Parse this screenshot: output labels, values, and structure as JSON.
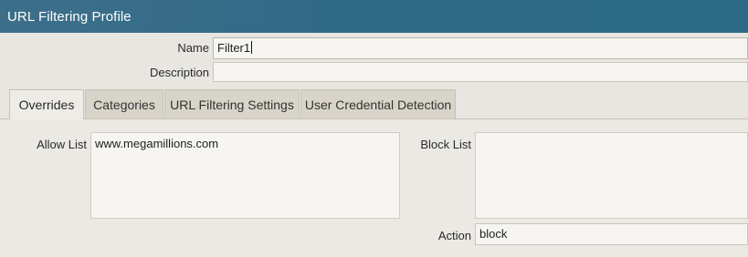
{
  "window": {
    "title": "URL Filtering Profile"
  },
  "form": {
    "name_label": "Name",
    "name_value": "Filter1",
    "description_label": "Description",
    "description_value": ""
  },
  "tabs": [
    {
      "label": "Overrides",
      "active": true
    },
    {
      "label": "Categories",
      "active": false
    },
    {
      "label": "URL Filtering Settings",
      "active": false
    },
    {
      "label": "User Credential Detection",
      "active": false
    }
  ],
  "overrides": {
    "allow_list_label": "Allow List",
    "allow_list_value": "www.megamillions.com",
    "block_list_label": "Block List",
    "block_list_value": "",
    "action_label": "Action",
    "action_value": "block"
  },
  "colors": {
    "title_bar": "#2f6987",
    "title_text": "#ffffff",
    "background": "#e8e6e1",
    "inactive_tab": "#d8d4c9",
    "active_tab": "#eeece7"
  }
}
